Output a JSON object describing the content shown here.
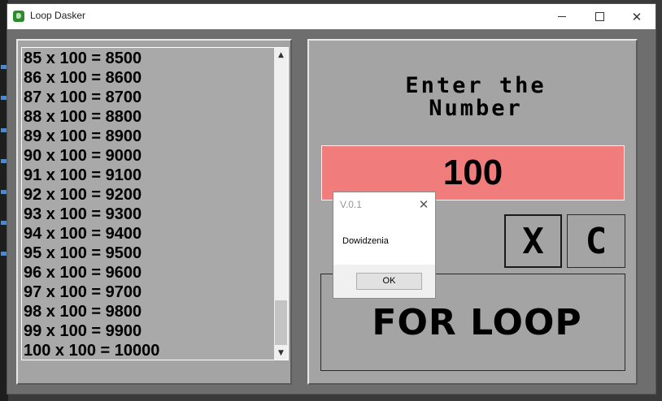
{
  "window": {
    "title": "Loop Dasker",
    "close_glyph": "✕"
  },
  "results": {
    "items": [
      "85 x 100 = 8500",
      "86 x 100 = 8600",
      "87 x 100 = 8700",
      "88 x 100 = 8800",
      "89 x 100 = 8900",
      "90 x 100 = 9000",
      "91 x 100 = 9100",
      "92 x 100 = 9200",
      "93 x 100 = 9300",
      "94 x 100 = 9400",
      "95 x 100 = 9500",
      "96 x 100 = 9600",
      "97 x 100 = 9700",
      "98 x 100 = 9800",
      "99 x 100 = 9900",
      "100 x 100 = 10000"
    ],
    "scroll_up_glyph": "▲",
    "scroll_down_glyph": "▼",
    "scroll_position": 1.0
  },
  "form": {
    "label_line1": "Enter the",
    "label_line2": "Number",
    "number_value": "100",
    "x_button": "X",
    "c_button": "C",
    "loop_button": "FOR LOOP",
    "field_color": "#f07c7c"
  },
  "dialog": {
    "title": "V.0.1",
    "close_glyph": "✕",
    "message": "Dowidzenia",
    "ok_label": "OK"
  },
  "icons": {
    "app_icon": "evernote-style-icon",
    "window_minimize": "minimize-icon",
    "window_maximize": "maximize-icon",
    "window_close": "close-icon"
  }
}
